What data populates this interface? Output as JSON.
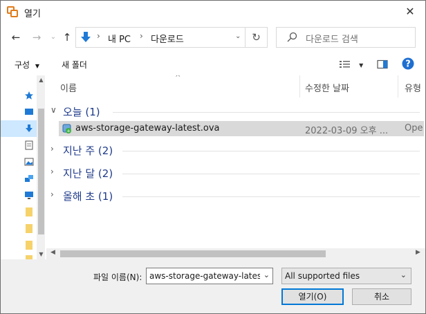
{
  "window": {
    "title": "열기"
  },
  "nav": {
    "address": {
      "root": "내 PC",
      "current": "다운로드"
    },
    "search_placeholder": "다운로드 검색"
  },
  "toolbar": {
    "organize": "구성",
    "new_folder": "새 폴더"
  },
  "list": {
    "headers": {
      "name": "이름",
      "modified": "수정한 날짜",
      "type": "유형"
    },
    "groups": [
      "오늘 (1)",
      "지난 주 (2)",
      "지난 달 (2)",
      "올해 초 (1)"
    ],
    "file": {
      "name": "aws-storage-gateway-latest.ova",
      "modified": "2022-03-09 오후 ...",
      "type": "Ope"
    }
  },
  "footer": {
    "filename_label": "파일 이름(N):",
    "filename_value": "aws-storage-gateway-latest.ova",
    "filetype_value": "All supported files",
    "open_label": "열기(O)",
    "cancel_label": "취소"
  },
  "colors": {
    "accent": "#0078d7",
    "selection": "#cde8ff",
    "group_text": "#1e3a8a"
  }
}
